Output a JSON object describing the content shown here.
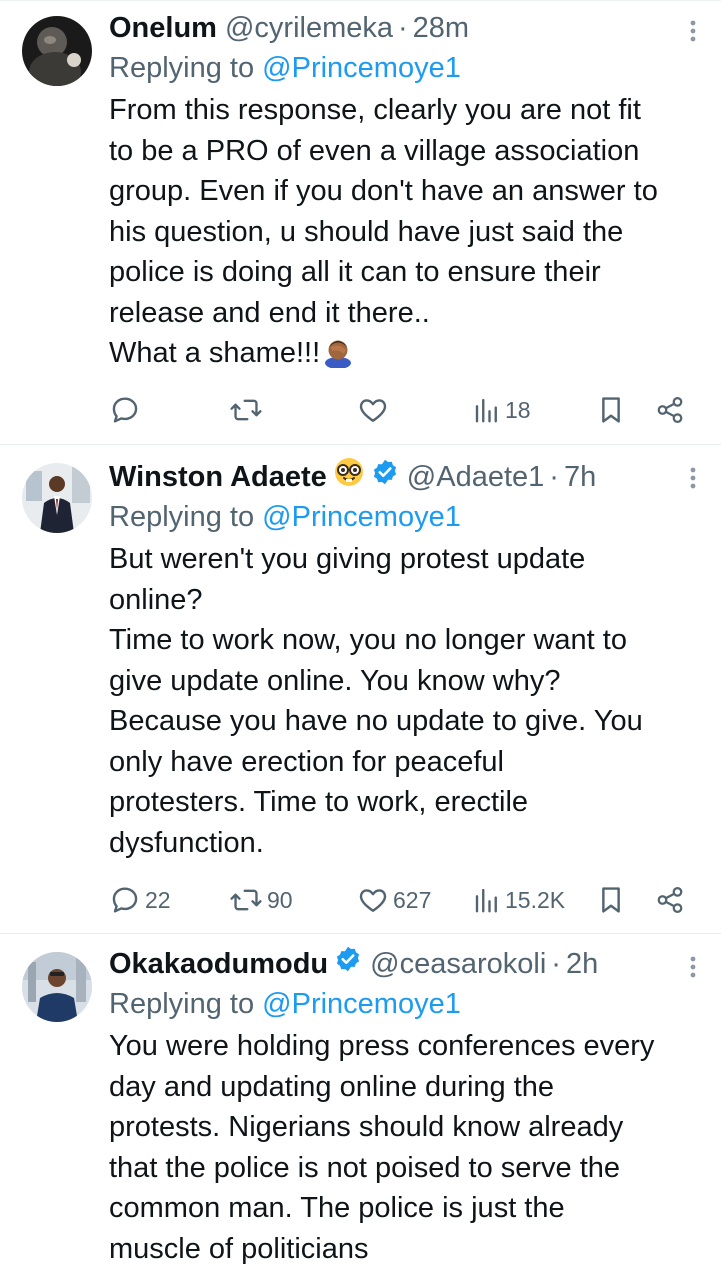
{
  "tweets": [
    {
      "name": "Onelum",
      "handle": "@cyrilemeka",
      "separator": "·",
      "time": "28m",
      "verified": false,
      "reply_prefix": "Replying to ",
      "reply_to": "@Princemoye1",
      "body": "From this response, clearly you are not fit\nto be a PRO of even a village association\ngroup. Even if you don't have an answer to\nhis question, u should have just said the\npolice is doing all it can to ensure their\nrelease and end it there..\nWhat a shame!!!",
      "trailing_emoji": "facepalm-emoji",
      "stats": {
        "replies": "",
        "reposts": "",
        "likes": "",
        "views": "18"
      }
    },
    {
      "name": "Winston Adaete",
      "name_emoji": "nerd-face-emoji",
      "handle": "@Adaete1",
      "separator": "·",
      "time": "7h",
      "verified": true,
      "reply_prefix": "Replying to ",
      "reply_to": "@Princemoye1",
      "body": "But weren't you giving protest update\nonline?\nTime to work now, you no longer want to\ngive update online. You know why?\nBecause you have no update to give. You\nonly have erection for peaceful\nprotesters. Time to work, erectile\ndysfunction.",
      "stats": {
        "replies": "22",
        "reposts": "90",
        "likes": "627",
        "views": "15.2K"
      }
    },
    {
      "name": "Okakaodumodu",
      "handle": "@ceasarokoli",
      "separator": "·",
      "time": "2h",
      "verified": true,
      "reply_prefix": "Replying to ",
      "reply_to": "@Princemoye1",
      "body": "You were holding press conferences every\nday and updating online during the\nprotests. Nigerians should know already\nthat the police is not poised to serve the\ncommon man. The police is just the\nmuscle of politicians"
    }
  ],
  "colors": {
    "text": "#0f1419",
    "secondary": "#536471",
    "link": "#1d9bf0",
    "verified": "#1d9bf0",
    "divider": "#e6ecf0"
  },
  "icons": [
    "reply-icon",
    "repost-icon",
    "like-icon",
    "views-icon",
    "bookmark-icon",
    "share-icon",
    "more-icon",
    "verified-badge-icon"
  ]
}
